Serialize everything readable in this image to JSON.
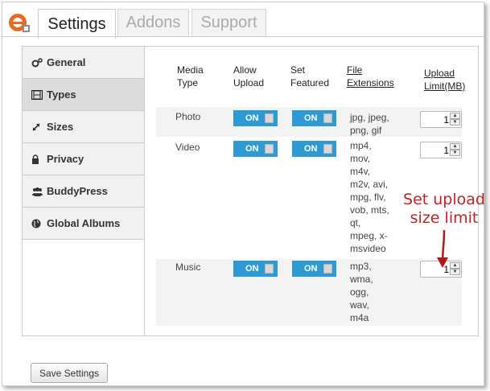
{
  "tabs": [
    {
      "label": "Settings",
      "active": true
    },
    {
      "label": "Addons",
      "active": false
    },
    {
      "label": "Support",
      "active": false
    }
  ],
  "sidebar": {
    "items": [
      {
        "label": "General",
        "icon": "cogs-icon"
      },
      {
        "label": "Types",
        "icon": "film-icon",
        "active": true
      },
      {
        "label": "Sizes",
        "icon": "resize-icon"
      },
      {
        "label": "Privacy",
        "icon": "lock-icon"
      },
      {
        "label": "BuddyPress",
        "icon": "group-icon"
      },
      {
        "label": "Global Albums",
        "icon": "globe-icon"
      }
    ]
  },
  "table": {
    "headers": {
      "media_type": [
        "Media",
        "Type"
      ],
      "allow_upload": [
        "Allow",
        "Upload"
      ],
      "set_featured": [
        "Set",
        "Featured"
      ],
      "file_extensions": [
        "File",
        "Extensions"
      ],
      "upload_limit": [
        "Upload",
        "Limit(MB)"
      ]
    },
    "rows": [
      {
        "type": "Photo",
        "allow_upload": "ON",
        "set_featured": "ON",
        "extensions": [
          "jpg, jpeg,",
          "png, gif"
        ],
        "limit": "1"
      },
      {
        "type": "Video",
        "allow_upload": "ON",
        "set_featured": "ON",
        "extensions": [
          "mp4,",
          "mov,",
          "m4v,",
          "m2v, avi,",
          "mpg, flv,",
          "vob, mts,",
          "qt,",
          "mpeg, x-",
          "msvideo"
        ],
        "limit": "1"
      },
      {
        "type": "Music",
        "allow_upload": "ON",
        "set_featured": "ON",
        "extensions": [
          "mp3,",
          "wma,",
          "ogg,",
          "wav,",
          "m4a"
        ],
        "limit": "1"
      }
    ]
  },
  "annotation": {
    "line1": "Set upload",
    "line2": "size limit"
  },
  "footer": {
    "save_label": "Save Settings"
  },
  "colors": {
    "toggle_on": "#2e9ad3",
    "annotation": "#c22222"
  }
}
